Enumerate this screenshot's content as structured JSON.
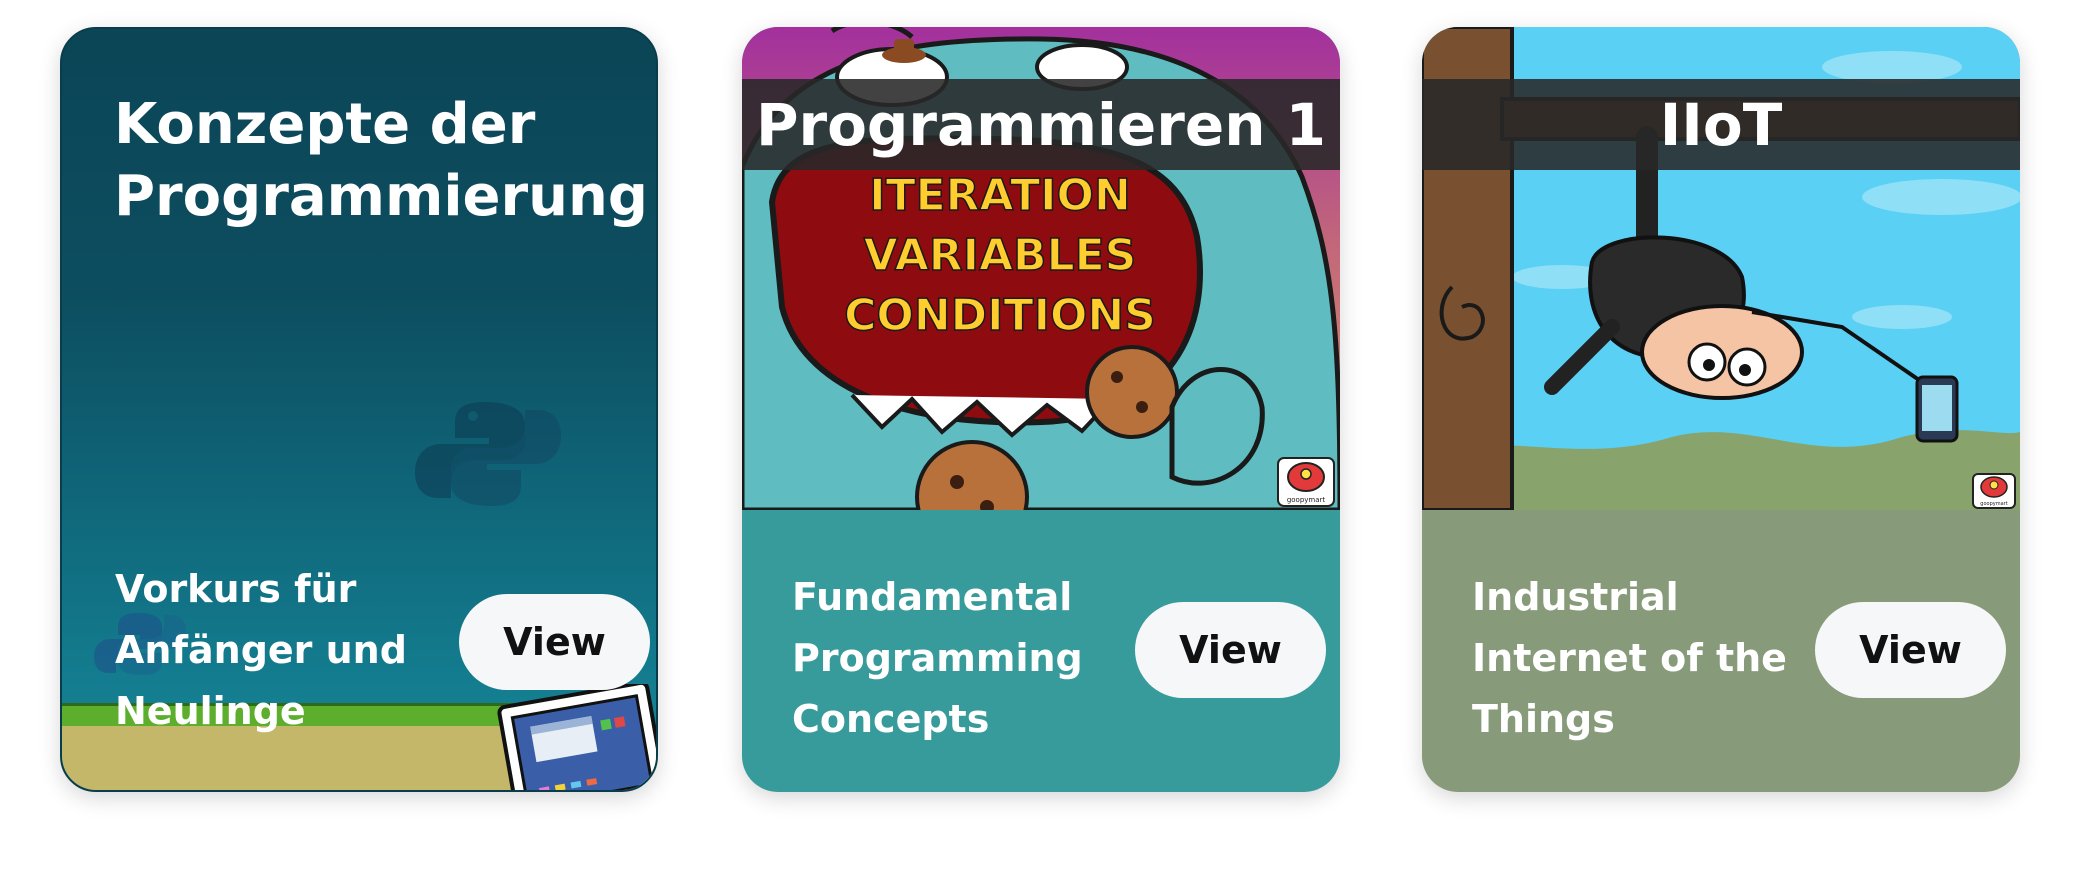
{
  "cards": [
    {
      "title": "Konzepte der Programmierung",
      "description": "Vorkurs für Anfänger und Neulinge",
      "button_label": "View",
      "icons": [
        "python-logo-icon",
        "computer-window-icon"
      ],
      "colors": {
        "background_top": "#0b4556",
        "background_bottom": "#168a9c"
      }
    },
    {
      "title": "Programmieren 1",
      "description": "Fundamental Programming Concepts",
      "button_label": "View",
      "image_text": [
        "ITERATION",
        "VARIABLES",
        "CONDITIONS"
      ],
      "badge_text": "goopymart",
      "colors": {
        "background": "#379a9b",
        "accent": "#ffce2e"
      }
    },
    {
      "title": "IIoT",
      "description": "Industrial Internet of the Things",
      "button_label": "View",
      "badge_text": "goopymart",
      "colors": {
        "background": "#879a79",
        "sky": "#5bd0f5"
      }
    }
  ]
}
